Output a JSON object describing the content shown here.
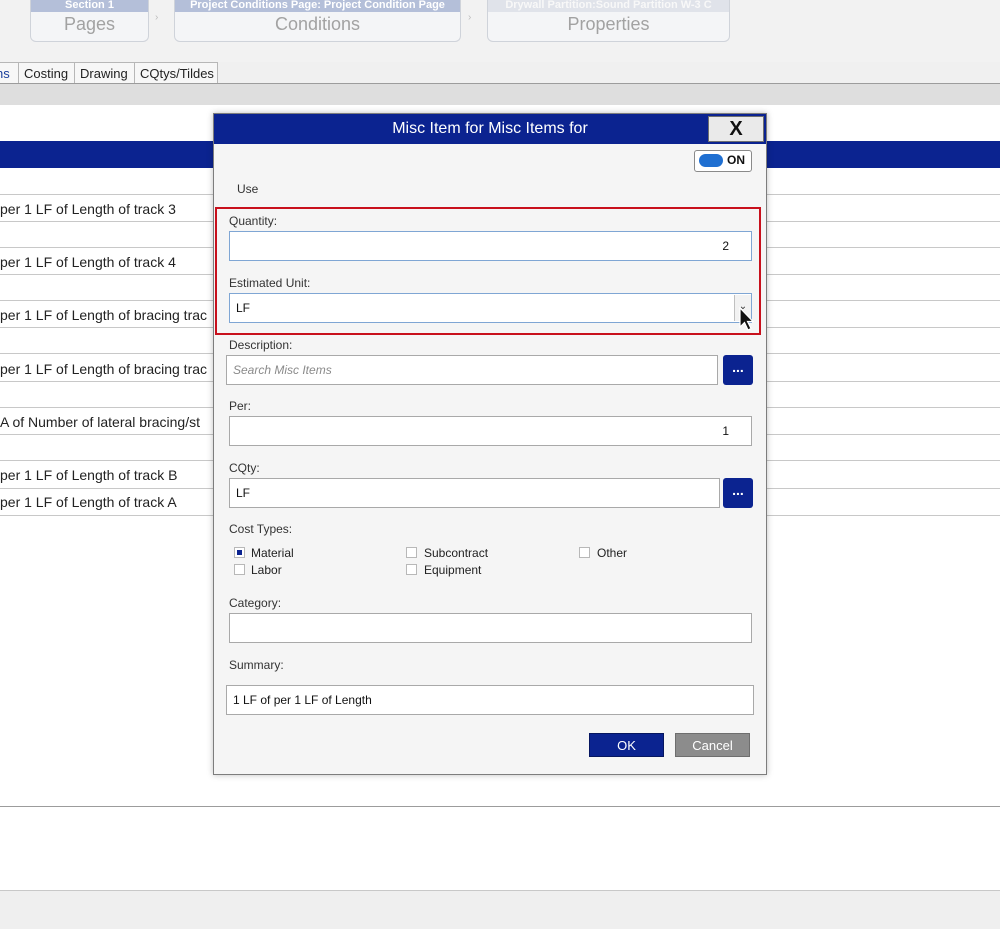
{
  "breadcrumb": [
    {
      "top": "Section 1",
      "label": "Pages"
    },
    {
      "top": "Project Conditions Page: Project Condition Page",
      "label": "Conditions"
    },
    {
      "top": "Drywall Partition:Sound Partition W-3 C",
      "label": "Properties"
    }
  ],
  "tabs": [
    "ns",
    "Costing",
    "Drawing",
    "CQtys/Tildes"
  ],
  "background_rows": [
    "per 1 LF of Length of track 3",
    "per 1 LF of Length of track 4",
    "per 1 LF of Length of bracing trac",
    "per 1 LF of Length of bracing trac",
    "A of Number of lateral bracing/st",
    "per 1 LF of Length of track B",
    "per 1 LF of Length of track A"
  ],
  "dialog": {
    "title": "Misc Item for Misc Items for",
    "close_label": "X",
    "toggle_label": "ON",
    "use_label": "Use",
    "quantity_label": "Quantity:",
    "quantity_value": "2",
    "estimated_unit_label": "Estimated Unit:",
    "estimated_unit_value": "LF",
    "description_label": "Description:",
    "description_placeholder": "Search Misc Items",
    "per_label": "Per:",
    "per_value": "1",
    "cqty_label": "CQty:",
    "cqty_value": "LF",
    "dots_label": "...",
    "cost_types_label": "Cost Types:",
    "cost_types": [
      {
        "label": "Material",
        "checked": true
      },
      {
        "label": "Labor",
        "checked": false
      },
      {
        "label": "Subcontract",
        "checked": false
      },
      {
        "label": "Equipment",
        "checked": false
      },
      {
        "label": "Other",
        "checked": false
      }
    ],
    "category_label": "Category:",
    "category_value": "",
    "summary_label": "Summary:",
    "summary_value": "1 LF of  per 1 LF of Length",
    "ok_label": "OK",
    "cancel_label": "Cancel"
  },
  "colors": {
    "accent": "#0b2390",
    "highlight": "#c8101c",
    "toggle": "#1f6fd1"
  },
  "icons": [
    "close-icon",
    "chevron-down-icon",
    "toggle-switch-icon",
    "cursor-icon"
  ]
}
